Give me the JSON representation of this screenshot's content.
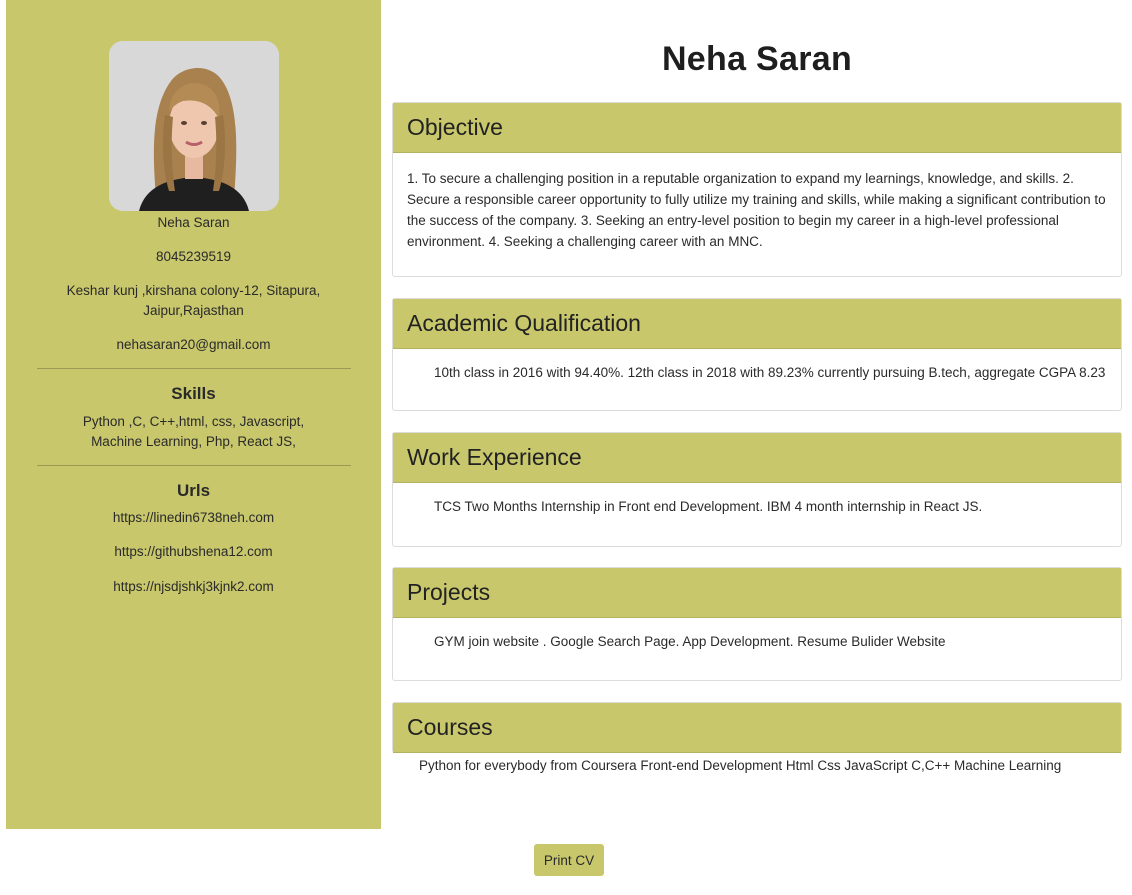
{
  "profile": {
    "name": "Neha Saran",
    "phone": "8045239519",
    "address": "Keshar kunj ,kirshana colony-12, Sitapura, Jaipur,Rajasthan",
    "email": "nehasaran20@gmail.com",
    "photo_icon": "profile-photo"
  },
  "skills": {
    "heading": "Skills",
    "text": "Python ,C, C++,html, css, Javascript, Machine Learning, Php, React JS,"
  },
  "urls": {
    "heading": "Urls",
    "items": [
      "https://linedin6738neh.com",
      "https://githubshena12.com",
      "https://njsdjshkj3kjnk2.com"
    ]
  },
  "main": {
    "title": "Neha Saran",
    "sections": [
      {
        "heading": "Objective",
        "body": "1. To secure a challenging position in a reputable organization to expand my learnings, knowledge, and skills. 2. Secure a responsible career opportunity to fully utilize my training and skills, while making a significant contribution to the success of the company. 3. Seeking an entry-level position to begin my career in a high-level professional environment. 4. Seeking a challenging career with an MNC."
      },
      {
        "heading": "Academic Qualification",
        "body": "10th class in 2016 with 94.40%. 12th class in 2018 with 89.23% currently pursuing B.tech, aggregate CGPA 8.23"
      },
      {
        "heading": "Work Experience",
        "body": "TCS Two Months Internship in Front end Development. IBM 4 month internship in React JS."
      },
      {
        "heading": "Projects",
        "body": "GYM join website . Google Search Page. App Development. Resume Bulider Website"
      },
      {
        "heading": "Courses",
        "body": "Python for everybody from Coursera Front-end Development Html Css JavaScript C,C++ Machine Learning"
      }
    ]
  },
  "actions": {
    "print_label": "Print CV"
  },
  "colors": {
    "accent": "#c8c76c",
    "text": "#212529",
    "border": "#dcdcdc"
  }
}
